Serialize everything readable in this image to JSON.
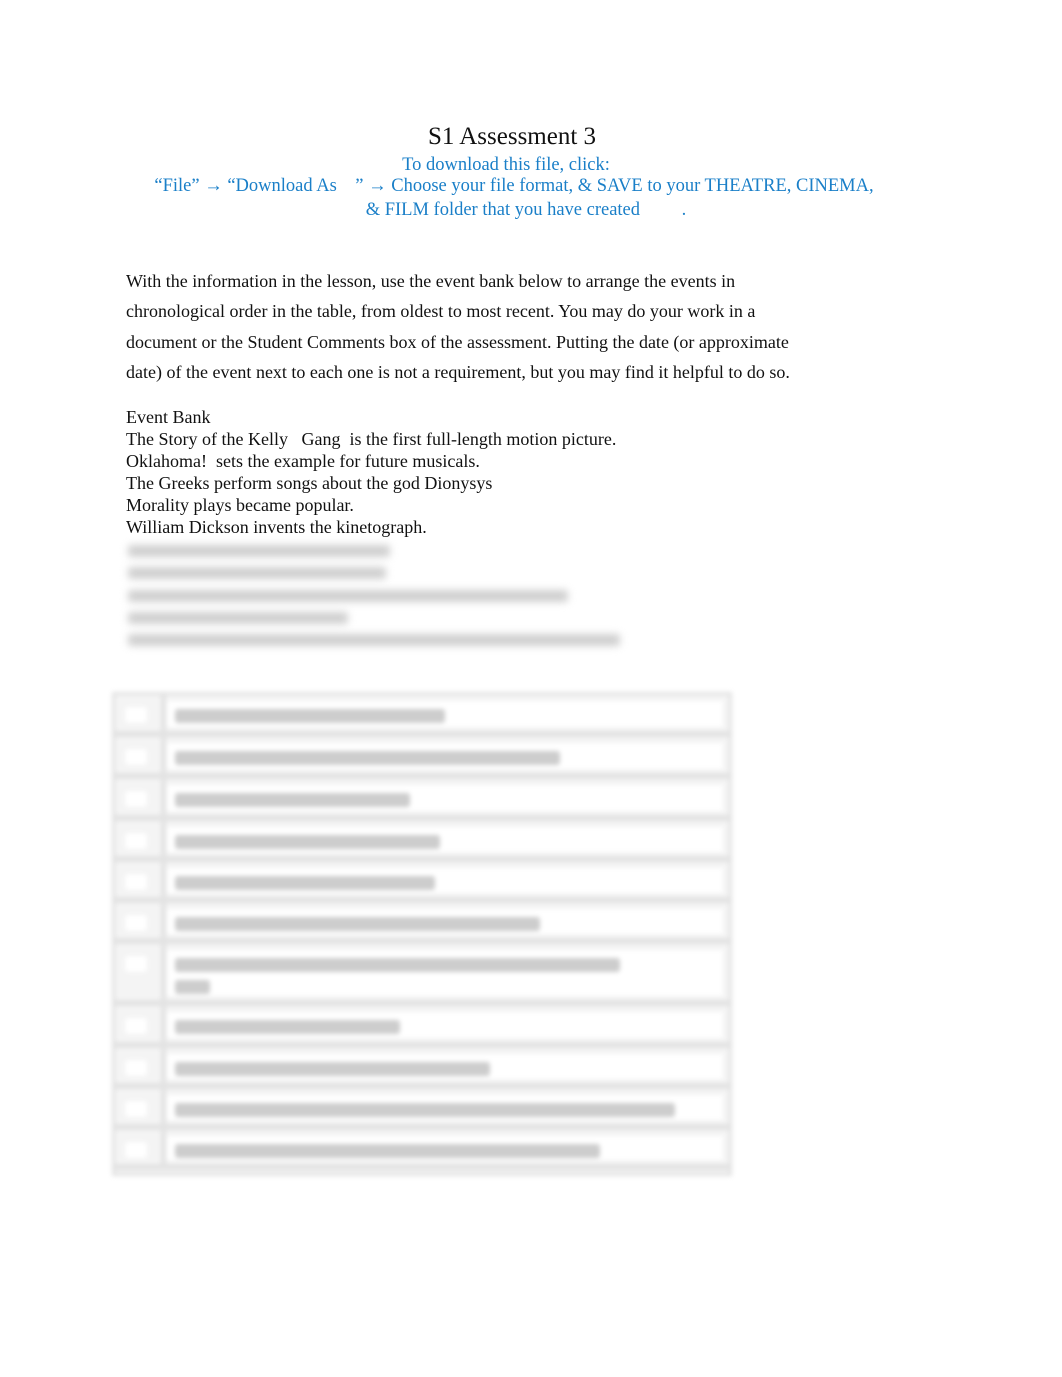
{
  "document": {
    "title": "S1 Assessment 3",
    "instructions": {
      "line1": "To download this file, click:",
      "line2": "“File” → “Download As    ” → Choose your file format, & SAVE to your THEATRE, CINEMA,",
      "line3": "& FILM folder that you have created         .",
      "color": "#1a7fc8"
    },
    "paragraph_lines": [
      "With the information in the lesson, use the event bank below to arrange the events in",
      "chronological order in the table, from oldest to most recent. You may do your work in a",
      "document or the Student Comments box of the assessment. Putting the date (or approximate",
      "date) of the event next to each one is not a requirement, but you may find it helpful to do so."
    ],
    "event_bank": {
      "heading": "Event Bank",
      "items": [
        "The Story of the Kelly   Gang  is the first full-length motion picture.",
        "Oklahoma!  sets the example for future musicals.",
        "The Greeks perform songs about the god Dionysys",
        "Morality plays became popular.",
        "William Dickson invents the kinetograph."
      ]
    },
    "blurred_content": true
  }
}
